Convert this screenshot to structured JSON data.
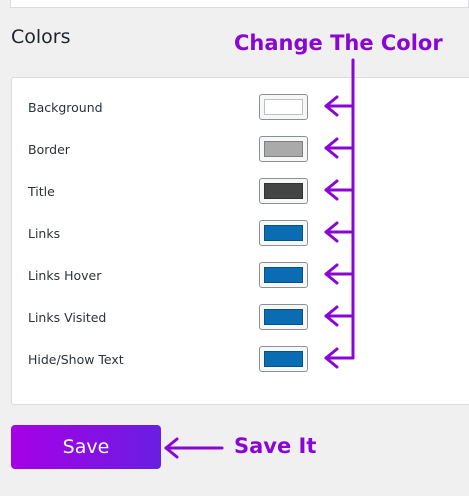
{
  "section": {
    "title": "Colors"
  },
  "color_rows": [
    {
      "label": "Background",
      "swatch": "#ffffff"
    },
    {
      "label": "Border",
      "swatch": "#aaaaaa"
    },
    {
      "label": "Title",
      "swatch": "#444444"
    },
    {
      "label": "Links",
      "swatch": "#0a6db4"
    },
    {
      "label": "Links Hover",
      "swatch": "#0a6db4"
    },
    {
      "label": "Links Visited",
      "swatch": "#0a6db4"
    },
    {
      "label": "Hide/Show Text",
      "swatch": "#0a6db4"
    }
  ],
  "save_button": {
    "label": "Save"
  },
  "annotations": {
    "change_color": "Change The Color",
    "save_it": "Save It",
    "color": "#8a06d4"
  }
}
